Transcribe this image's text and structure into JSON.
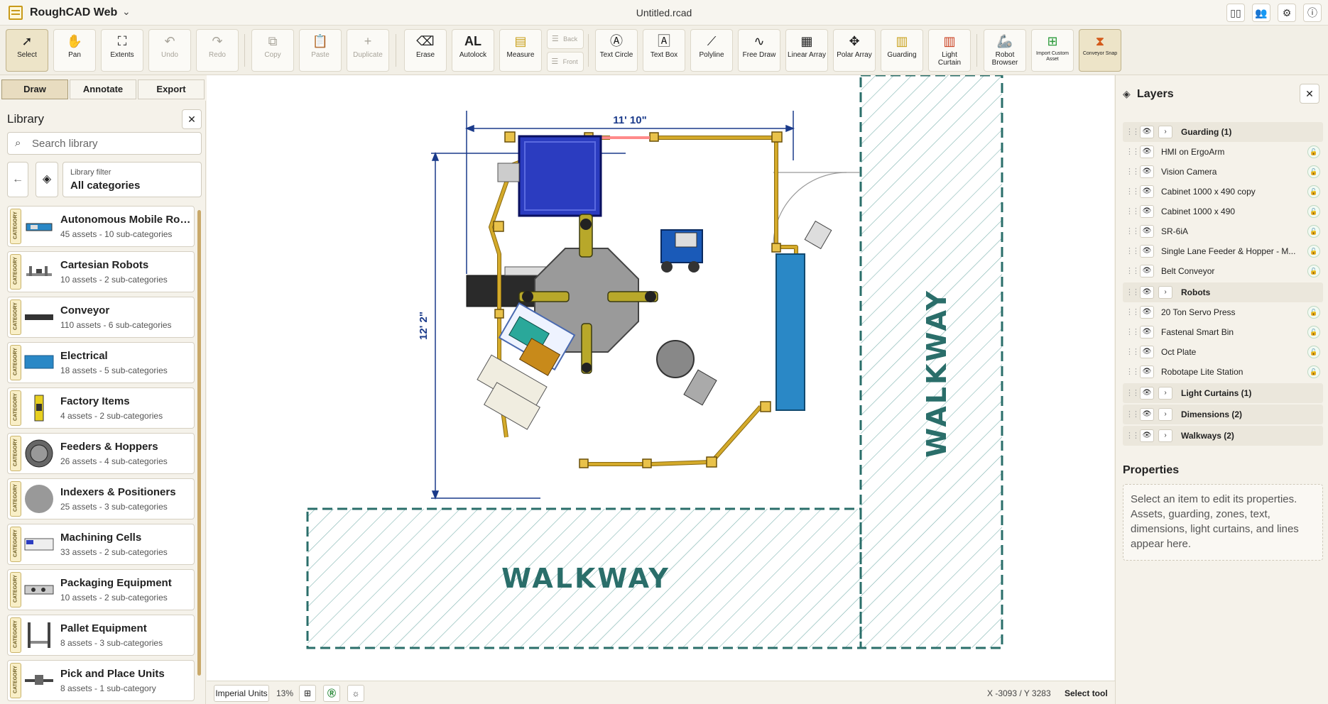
{
  "app": {
    "name": "RoughCAD Web",
    "document_title": "Untitled.rcad"
  },
  "title_icons": [
    "book-icon",
    "users-icon",
    "gear-icon",
    "info-icon"
  ],
  "toolbar": {
    "select": "Select",
    "pan": "Pan",
    "extents": "Extents",
    "undo": "Undo",
    "redo": "Redo",
    "copy": "Copy",
    "paste": "Paste",
    "duplicate": "Duplicate",
    "erase": "Erase",
    "autolock": "Autolock",
    "measure": "Measure",
    "back": "Back",
    "front": "Front",
    "text_circle": "Text Circle",
    "text_box": "Text Box",
    "polyline": "Polyline",
    "free_draw": "Free Draw",
    "linear_array": "Linear Array",
    "polar_array": "Polar Array",
    "guarding": "Guarding",
    "light_curtain": "Light Curtain",
    "robot_browser": "Robot Browser",
    "import_custom_asset": "Import Custom Asset",
    "conveyor_snap": "Conveyor Snap"
  },
  "tabs": [
    "Draw",
    "Annotate",
    "Export"
  ],
  "library": {
    "title": "Library",
    "search_placeholder": "Search library",
    "filter_label": "Library filter",
    "filter_value": "All categories",
    "badge_text": "CATEGORY",
    "categories": [
      {
        "name": "Autonomous Mobile Robots",
        "sub": "45 assets - 10 sub-categories"
      },
      {
        "name": "Cartesian Robots",
        "sub": "10 assets - 2 sub-categories"
      },
      {
        "name": "Conveyor",
        "sub": "110 assets - 6 sub-categories"
      },
      {
        "name": "Electrical",
        "sub": "18 assets - 5 sub-categories"
      },
      {
        "name": "Factory Items",
        "sub": "4 assets - 2 sub-categories"
      },
      {
        "name": "Feeders & Hoppers",
        "sub": "26 assets - 4 sub-categories"
      },
      {
        "name": "Indexers & Positioners",
        "sub": "25 assets - 3 sub-categories"
      },
      {
        "name": "Machining Cells",
        "sub": "33 assets - 2 sub-categories"
      },
      {
        "name": "Packaging Equipment",
        "sub": "10 assets - 2 sub-categories"
      },
      {
        "name": "Pallet Equipment",
        "sub": "8 assets - 3 sub-categories"
      },
      {
        "name": "Pick and Place Units",
        "sub": "8 assets - 1 sub-category"
      }
    ]
  },
  "canvas": {
    "dim_width": "11' 10\"",
    "dim_height": "12' 2\"",
    "walkway_label": "WALKWAY",
    "colors": {
      "guarding": "#d4aa2a",
      "dimension": "#1a3a8a",
      "walkway": "#2a6e6a",
      "cabinet_blue": "#2b3cc0",
      "conveyor_blue": "#2a88c6"
    }
  },
  "layers": {
    "title": "Layers",
    "items": [
      {
        "type": "group",
        "name": "Guarding (1)"
      },
      {
        "type": "item",
        "name": "HMI on ErgoArm"
      },
      {
        "type": "item",
        "name": "Vision Camera"
      },
      {
        "type": "item",
        "name": "Cabinet 1000 x 490 copy"
      },
      {
        "type": "item",
        "name": "Cabinet 1000 x 490"
      },
      {
        "type": "item",
        "name": "SR-6iA"
      },
      {
        "type": "item",
        "name": "Single Lane Feeder & Hopper - M..."
      },
      {
        "type": "item",
        "name": "Belt Conveyor"
      },
      {
        "type": "group",
        "name": "Robots"
      },
      {
        "type": "item",
        "name": "20 Ton Servo Press"
      },
      {
        "type": "item",
        "name": "Fastenal Smart Bin"
      },
      {
        "type": "item",
        "name": "Oct Plate"
      },
      {
        "type": "item",
        "name": "Robotape Lite Station"
      },
      {
        "type": "group",
        "name": "Light Curtains (1)"
      },
      {
        "type": "group",
        "name": "Dimensions (2)"
      },
      {
        "type": "group",
        "name": "Walkways (2)"
      }
    ]
  },
  "properties": {
    "title": "Properties",
    "placeholder": "Select an item to edit its properties. Assets, guarding, zones, text, dimensions, light curtains, and lines appear here."
  },
  "status": {
    "units": "Imperial Units",
    "zoom": "13%",
    "coords": "X -3093 / Y 3283",
    "tool": "Select tool"
  }
}
